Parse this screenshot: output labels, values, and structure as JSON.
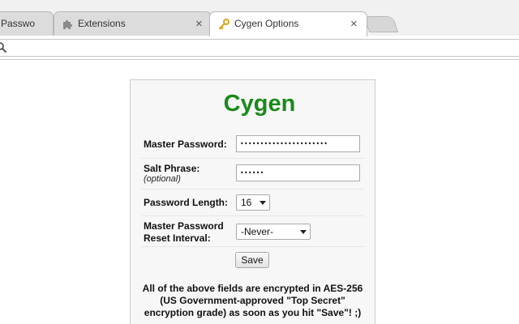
{
  "tabs": [
    {
      "label": "Passwo",
      "icon": "page-icon",
      "close_label": "×",
      "active": false
    },
    {
      "label": "Extensions",
      "icon": "puzzle-piece-icon",
      "close_label": "×",
      "active": false
    },
    {
      "label": "Cygen Options",
      "icon": "key-icon",
      "close_label": "×",
      "active": true
    }
  ],
  "address_bar": {
    "value": "",
    "icon": "search-icon"
  },
  "options": {
    "title": "Cygen",
    "title_color": "#1a8a1a",
    "master_password": {
      "label": "Master Password:",
      "value": "••••••••••••••••••••••"
    },
    "salt_phrase": {
      "label": "Salt Phrase:",
      "hint": "(optional)",
      "value": "••••••"
    },
    "password_length": {
      "label": "Password Length:",
      "selected": "16"
    },
    "reset_interval": {
      "label_line1": "Master Password",
      "label_line2": "Reset Interval:",
      "selected": "-Never-"
    },
    "save_label": "Save",
    "notice": {
      "line1": "All of the above fields are encrypted in AES-256",
      "line2": "(US Government-approved \"Top Secret\"",
      "line3": "encryption grade) as soon as you hit \"Save\"! ;)"
    }
  }
}
